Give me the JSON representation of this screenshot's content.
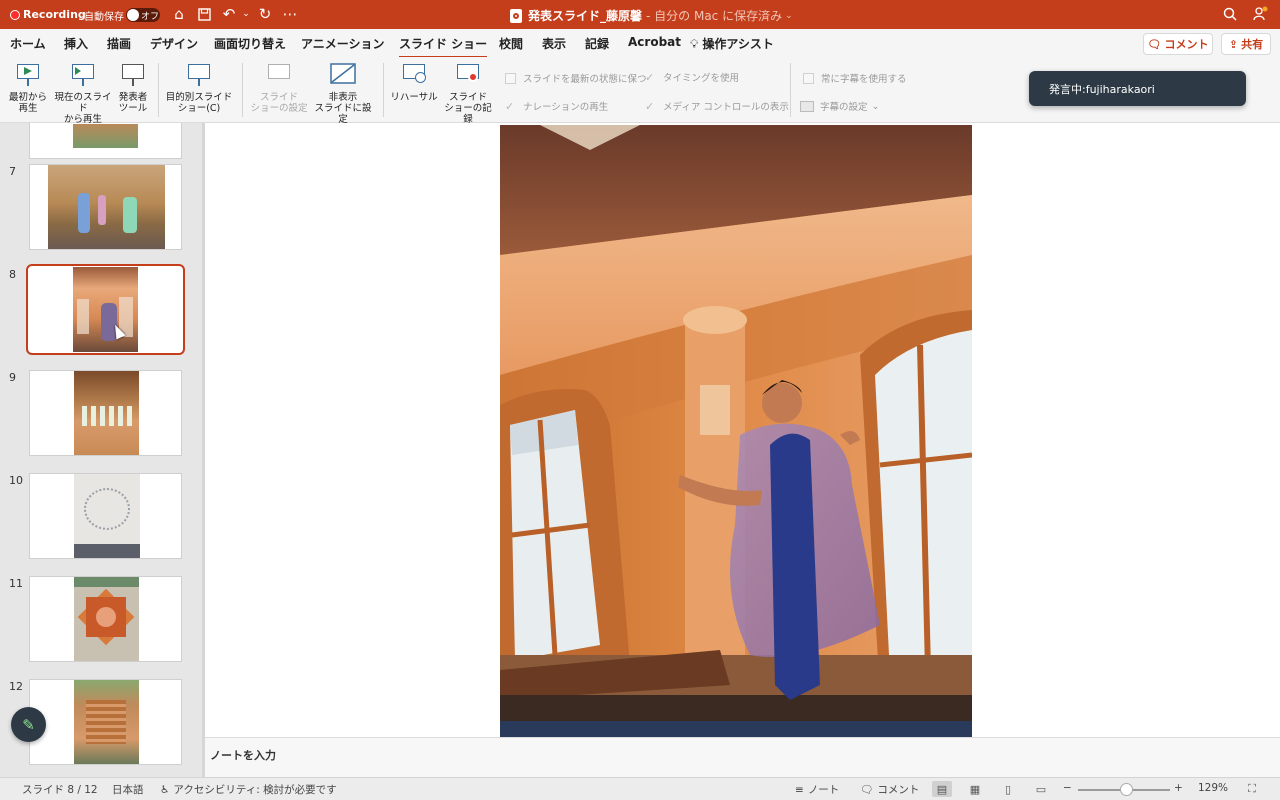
{
  "titlebar": {
    "recording_label": "Recording",
    "autosave_label": "自動保存",
    "autosave_state": "オフ",
    "doc_name": "発表スライド_藤原馨",
    "save_location": "- 自分の Mac に保存済み",
    "color": "#c43e1c"
  },
  "menu": {
    "tabs": [
      "ホーム",
      "挿入",
      "描画",
      "デザイン",
      "画面切り替え",
      "アニメーション",
      "スライド ショー",
      "校閲",
      "表示",
      "記録",
      "Acrobat",
      "操作アシスト"
    ],
    "active_tab": "スライド ショー",
    "comment_button": "コメント",
    "share_button": "共有"
  },
  "ribbon": {
    "from_start": [
      "最初から",
      "再生"
    ],
    "from_current": [
      "現在のスライド",
      "から再生"
    ],
    "presenter_tools": [
      "発表者",
      "ツール"
    ],
    "custom_show": [
      "目的別スライド",
      "ショー(C)"
    ],
    "setup_show": [
      "スライド",
      "ショーの設定"
    ],
    "hide_slide": [
      "非表示",
      "スライドに設定"
    ],
    "rehearse": [
      "リハーサル"
    ],
    "record_show": [
      "スライド",
      "ショーの記録"
    ],
    "keep_updated": "スライドを最新の状態に保つ",
    "use_timings": "タイミングを使用",
    "play_narrations": "ナレーションの再生",
    "show_media_controls": "メディア コントロールの表示",
    "always_subtitles": "常に字幕を使用する",
    "subtitle_settings": "字幕の設定"
  },
  "toast": {
    "text": "発言中:fujiharakaori"
  },
  "thumbnails": {
    "numbers": [
      "7",
      "8",
      "9",
      "10",
      "11",
      "12"
    ],
    "selected": "8"
  },
  "notes": {
    "placeholder": "ノートを入力"
  },
  "status": {
    "slide_indicator": "スライド 8 / 12",
    "language": "日本語",
    "accessibility": "アクセシビリティ: 検討が必要です",
    "notes_label": "ノート",
    "comments_label": "コメント",
    "zoom": "129%",
    "zoom_level": 0.48
  }
}
